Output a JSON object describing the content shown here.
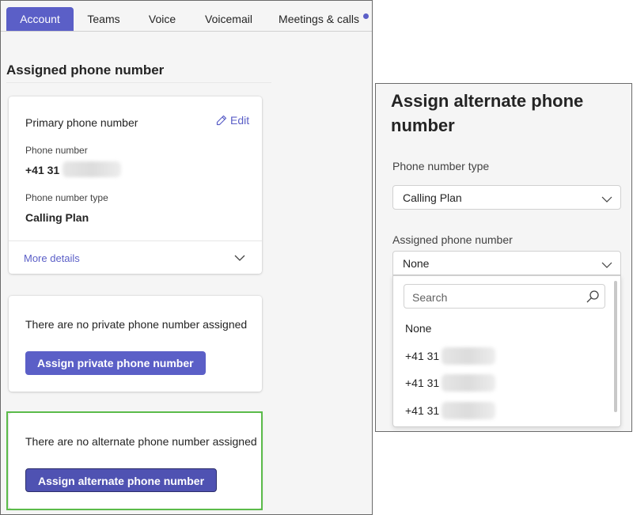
{
  "tabs": [
    {
      "label": "Account",
      "active": true
    },
    {
      "label": "Teams",
      "active": false
    },
    {
      "label": "Voice",
      "active": false
    },
    {
      "label": "Voicemail",
      "active": false
    },
    {
      "label": "Meetings & calls",
      "active": false,
      "has_dot": true
    }
  ],
  "section": {
    "title": "Assigned phone number"
  },
  "primary_card": {
    "title": "Primary phone number",
    "edit_label": "Edit",
    "phone_number_label": "Phone number",
    "phone_number_prefix": "+41 31",
    "phone_type_label": "Phone number type",
    "phone_type_value": "Calling Plan",
    "more_details_label": "More details"
  },
  "private_card": {
    "message": "There are no private phone number assigned",
    "button_label": "Assign private phone number"
  },
  "alternate_card": {
    "message": "There are no alternate phone number assigned",
    "button_label": "Assign alternate phone number"
  },
  "assign_panel": {
    "title": "Assign alternate phone number",
    "phone_type_label": "Phone number type",
    "phone_type_value": "Calling Plan",
    "assigned_label": "Assigned phone number",
    "assigned_value": "None",
    "search_placeholder": "Search",
    "options": [
      "None",
      "+41 31",
      "+41 31",
      "+41 31"
    ]
  },
  "colors": {
    "brand": "#5b5fc7",
    "highlight": "#5bbb4a"
  },
  "icons": {
    "edit": "pencil-icon",
    "chevron": "chevron-down-icon",
    "search": "search-icon"
  }
}
